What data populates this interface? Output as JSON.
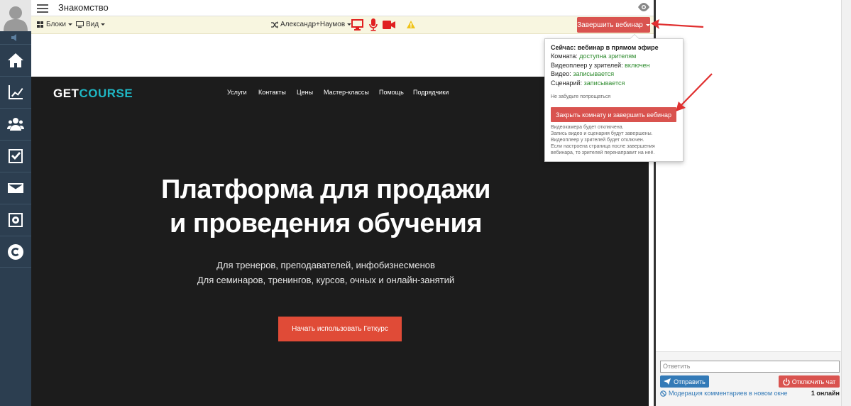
{
  "header": {
    "title": "Знакомство"
  },
  "toolbar": {
    "blocks_label": "Блоки",
    "view_label": "Вид",
    "presenter_label": "Александр+Наумов",
    "finish_label": "Завершить вебинар",
    "accent_color": "#d9534f"
  },
  "sidebar": {
    "items": [
      {
        "icon": "home-icon"
      },
      {
        "icon": "chart-icon"
      },
      {
        "icon": "users-icon"
      },
      {
        "icon": "checkbox-icon"
      },
      {
        "icon": "mail-icon"
      },
      {
        "icon": "safe-icon"
      },
      {
        "icon": "getcourse-logo-icon"
      }
    ]
  },
  "stage": {
    "logo_part1": "GET",
    "logo_part2": "COURSE",
    "nav": [
      "Услуги",
      "Контакты",
      "Цены",
      "Мастер-классы",
      "Помощь",
      "Подрядчики"
    ],
    "hero_line1": "Платформа для продажи",
    "hero_line2": "и проведения обучения",
    "sub_line1": "Для тренеров, преподавателей, инфобизнесменов",
    "sub_line2": "Для семинаров, тренингов, курсов, очных и онлайн-занятий",
    "cta_label": "Начать использовать Геткурс"
  },
  "popup": {
    "now_label": "Сейчас: вебинар в прямом эфире",
    "room_label": "Комната:",
    "room_value": "доступна зрителям",
    "player_label": "Видеоплеер у зрителей:",
    "player_value": "включен",
    "video_label": "Видео:",
    "video_value": "записывается",
    "scenario_label": "Сценарий:",
    "scenario_value": "записывается",
    "reminder": "Не забудьте попрощаться",
    "close_button": "Закрыть комнату и завершить вебинар",
    "note1": "Видеокамера будет отключена.",
    "note2": "Запись видео и сценария будут завершены.",
    "note3": "Видеоплеер у зрителей будет отключен.",
    "note4": "Если настроена страница после завершения",
    "note5": "вебинара, то зрителей перенаправит на неё."
  },
  "chat": {
    "reply_placeholder": "Ответить",
    "send_label": "Отправить",
    "off_label": "Отключить чат",
    "moderation_label": "Модерация комментариев в новом окне",
    "online_label": "1 онлайн"
  }
}
